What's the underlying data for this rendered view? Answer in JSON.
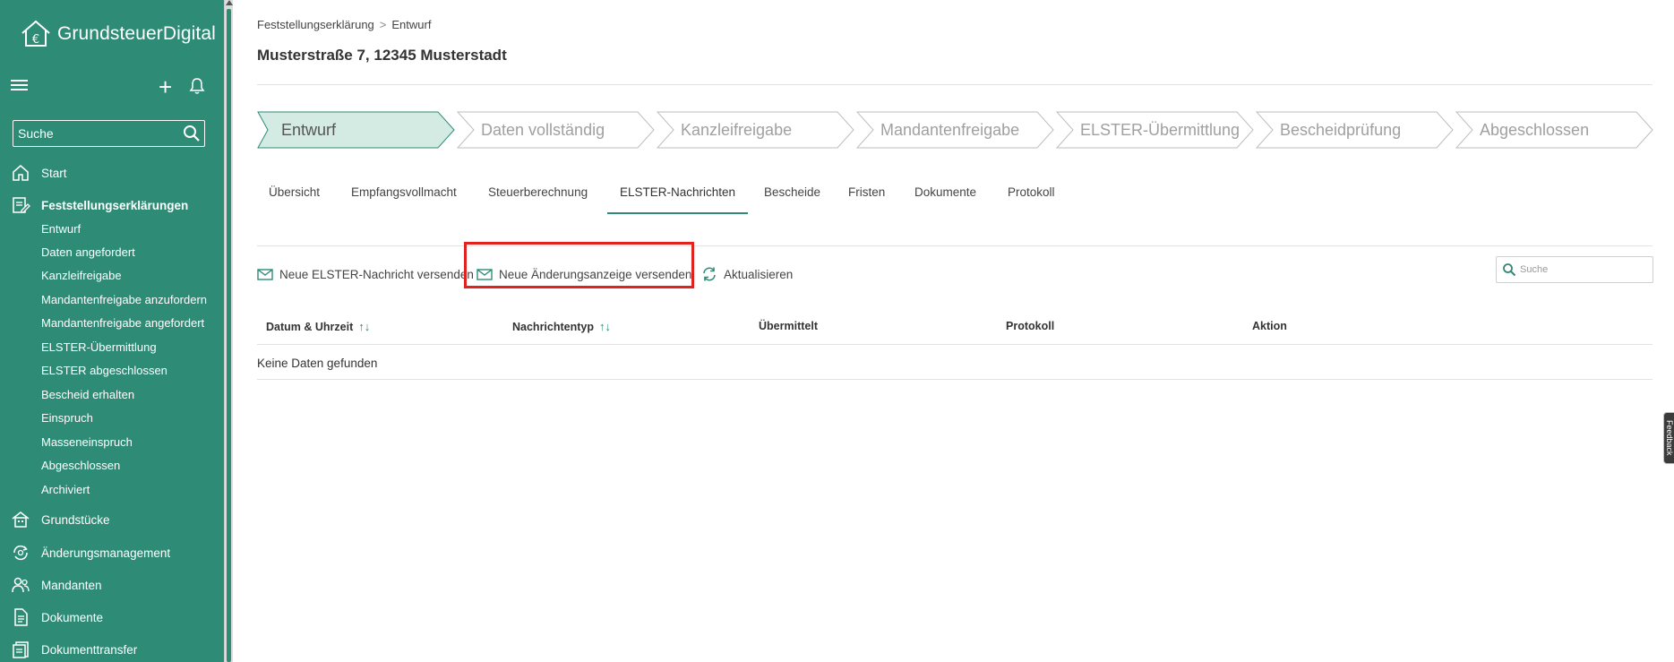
{
  "sidebar": {
    "brand": "GrundsteuerDigital",
    "search_placeholder": "Suche",
    "nav": {
      "start": "Start",
      "feststellung": "Feststellungserklärungen",
      "grundstuecke": "Grundstücke",
      "aenderung": "Änderungsmanagement",
      "mandanten": "Mandanten",
      "dokumente": "Dokumente",
      "dokumenttransfer": "Dokumenttransfer"
    },
    "subitems": [
      "Entwurf",
      "Daten angefordert",
      "Kanzleifreigabe",
      "Mandantenfreigabe anzufordern",
      "Mandantenfreigabe angefordert",
      "ELSTER-Übermittlung",
      "ELSTER abgeschlossen",
      "Bescheid erhalten",
      "Einspruch",
      "Masseneinspruch",
      "Abgeschlossen",
      "Archiviert"
    ]
  },
  "breadcrumb": {
    "parent": "Feststellungserklärung",
    "separator": ">",
    "current": "Entwurf"
  },
  "page_title": "Musterstraße 7, 12345 Musterstadt",
  "steps": [
    "Entwurf",
    "Daten vollständig",
    "Kanzleifreigabe",
    "Mandantenfreigabe",
    "ELSTER-Übermittlung",
    "Bescheidprüfung",
    "Abgeschlossen"
  ],
  "active_step": "Entwurf",
  "tabs": [
    "Übersicht",
    "Empfangsvollmacht",
    "Steuerberechnung",
    "ELSTER-Nachrichten",
    "Bescheide",
    "Fristen",
    "Dokumente",
    "Protokoll"
  ],
  "active_tab": "ELSTER-Nachrichten",
  "toolbar": {
    "new_elster": "Neue ELSTER-Nachricht versenden",
    "new_change": "Neue Änderungsanzeige versenden",
    "refresh": "Aktualisieren",
    "search_placeholder": "Suche"
  },
  "table": {
    "columns": [
      "Datum & Uhrzeit",
      "Nachrichtentyp",
      "Übermittelt",
      "Protokoll",
      "Aktion"
    ],
    "sort_glyph": "↑↓",
    "empty": "Keine Daten gefunden"
  },
  "feedback_tab": "Feedback",
  "colors": {
    "sidebar": "#2e8b76",
    "accent": "#2e8b76",
    "active_step_fill": "#d3ebe3",
    "highlight": "#e0231e"
  }
}
